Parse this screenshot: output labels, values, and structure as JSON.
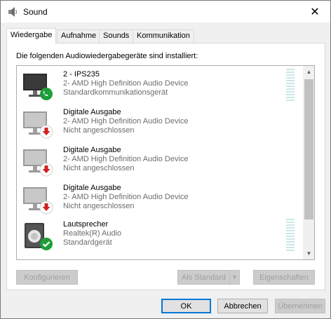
{
  "window": {
    "title": "Sound",
    "close_glyph": "✕"
  },
  "tabs": [
    {
      "label": "Wiedergabe"
    },
    {
      "label": "Aufnahme"
    },
    {
      "label": "Sounds"
    },
    {
      "label": "Kommunikation"
    }
  ],
  "panel": {
    "heading": "Die folgenden Audiowiedergabegeräte sind installiert:"
  },
  "devices": [
    {
      "name": "2 - IPS235",
      "driver": "2- AMD High Definition Audio Device",
      "status": "Standardkommunikationsgerät",
      "icon": "monitor-icon",
      "badge": "phone-badge-icon",
      "badge_color": "#1e9e3a"
    },
    {
      "name": "Digitale Ausgabe",
      "driver": "2- AMD High Definition Audio Device",
      "status": "Nicht angeschlossen",
      "icon": "monitor-icon",
      "badge": "down-arrow-badge-icon",
      "badge_color": "#d32020"
    },
    {
      "name": "Digitale Ausgabe",
      "driver": "2- AMD High Definition Audio Device",
      "status": "Nicht angeschlossen",
      "icon": "monitor-icon",
      "badge": "down-arrow-badge-icon",
      "badge_color": "#d32020"
    },
    {
      "name": "Digitale Ausgabe",
      "driver": "2- AMD High Definition Audio Device",
      "status": "Nicht angeschlossen",
      "icon": "monitor-icon",
      "badge": "down-arrow-badge-icon",
      "badge_color": "#d32020"
    },
    {
      "name": "Lautsprecher",
      "driver": "Realtek(R) Audio",
      "status": "Standardgerät",
      "icon": "speaker-icon",
      "badge": "checkmark-badge-icon",
      "badge_color": "#1e9e3a"
    }
  ],
  "buttons": {
    "configure": "Konfigurieren",
    "set_default": "Als Standard",
    "properties": "Eigenschaften",
    "ok": "OK",
    "cancel": "Abbrechen",
    "apply": "Übernehmen"
  },
  "colors": {
    "accent": "#0078d7",
    "meter": "#c9e8e6"
  }
}
